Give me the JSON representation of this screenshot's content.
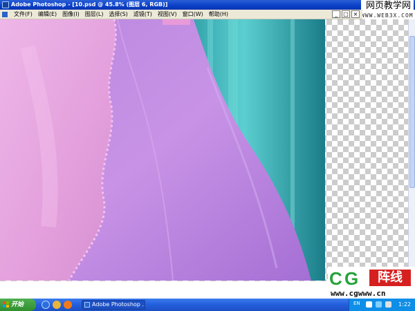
{
  "window": {
    "title": "Adobe Photoshop - [10.psd @ 45.8% (图层 6, RGB)]",
    "app_icon": "photoshop-icon"
  },
  "watermark_site": {
    "title": "网页教学网",
    "url": "WWW.WEB3X.COM"
  },
  "menu": {
    "items": [
      {
        "label": "文件(F)"
      },
      {
        "label": "编辑(E)"
      },
      {
        "label": "图像(I)"
      },
      {
        "label": "图层(L)"
      },
      {
        "label": "选择(S)"
      },
      {
        "label": "滤镜(T)"
      },
      {
        "label": "视图(V)"
      },
      {
        "label": "窗口(W)"
      },
      {
        "label": "帮助(H)"
      }
    ],
    "mdi_minimize": "_",
    "mdi_restore": "□",
    "mdi_close": "×"
  },
  "logo": {
    "c": "C",
    "g": "G",
    "chinese": "阵线",
    "url": "www.cgwww.cn"
  },
  "taskbar": {
    "start_label": "开始",
    "task_label": "Adobe Photoshop ...",
    "tray_lang": "EN",
    "clock": "1:22"
  },
  "colors": {
    "titlebar": "#0a3fc8",
    "fabric_pink": "#e7a2e0",
    "fabric_violet": "#c07ad8",
    "background_teal": "#1e8e9a",
    "logo_green": "#27a33a",
    "logo_red": "#d62020"
  }
}
